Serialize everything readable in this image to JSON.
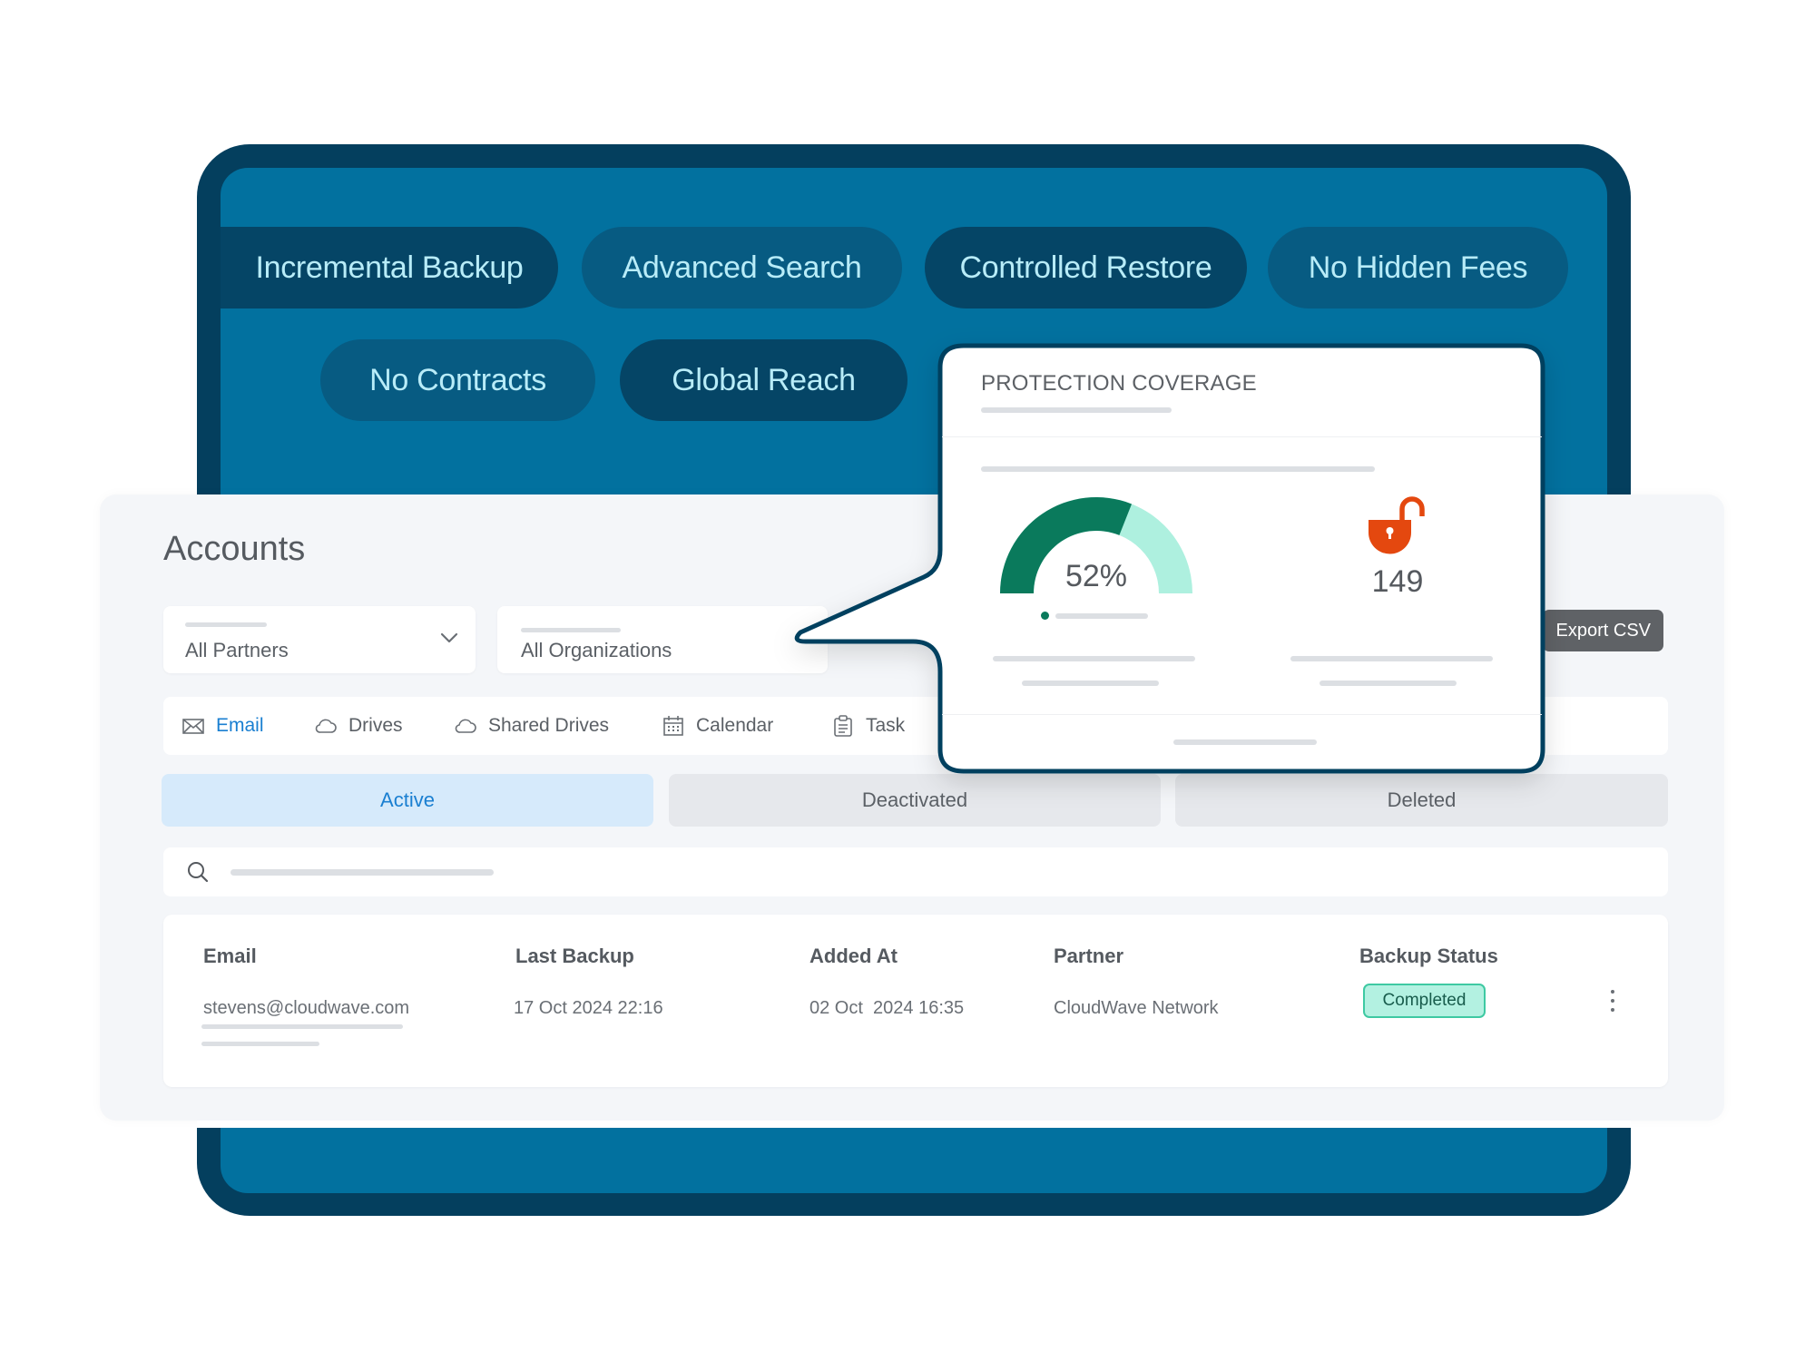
{
  "features": {
    "row1": [
      "Incremental Backup",
      "Advanced Search",
      "Controlled Restore",
      "No Hidden Fees"
    ],
    "row2": [
      "No Contracts",
      "Global Reach"
    ]
  },
  "accounts": {
    "title": "Accounts",
    "filters": {
      "partners": {
        "value": "All Partners",
        "icon": "chevron-down-icon"
      },
      "organizations": {
        "value": "All Organizations"
      }
    },
    "export_label": "Export CSV",
    "service_tabs": [
      {
        "label": "Email",
        "icon": "envelope-icon",
        "active": true
      },
      {
        "label": "Drives",
        "icon": "cloud-icon",
        "active": false
      },
      {
        "label": "Shared Drives",
        "icon": "cloud-icon",
        "active": false
      },
      {
        "label": "Calendar",
        "icon": "calendar-icon",
        "active": false
      },
      {
        "label": "Task",
        "icon": "clipboard-icon",
        "active": false
      }
    ],
    "status_tabs": [
      {
        "label": "Active",
        "active": true
      },
      {
        "label": "Deactivated",
        "active": false
      },
      {
        "label": "Deleted",
        "active": false
      }
    ],
    "search": {
      "icon": "search-icon",
      "placeholder": ""
    },
    "table": {
      "columns": [
        "Email",
        "Last Backup",
        "Added At",
        "Partner",
        "Backup Status"
      ],
      "rows": [
        {
          "email": "stevens@cloudwave.com",
          "last_backup": "17 Oct 2024 22:16",
          "added_at": "02 Oct  2024 16:35",
          "partner": "CloudWave Network",
          "backup_status": "Completed"
        }
      ]
    }
  },
  "popup": {
    "title": "PROTECTION COVERAGE",
    "gauge": {
      "label": "52%",
      "fill_fraction": 0.62,
      "fill_color": "#0a7a5c",
      "track_color": "#aef0df"
    },
    "unprotected": {
      "count": "149",
      "icon": "unlocked-padlock-icon",
      "color": "#e4480f"
    }
  },
  "colors": {
    "frame_dark": "#043f5e",
    "frame_blue": "#02719f",
    "accent_blue": "#1a7fd1",
    "status_green": "#3ec9a2"
  }
}
